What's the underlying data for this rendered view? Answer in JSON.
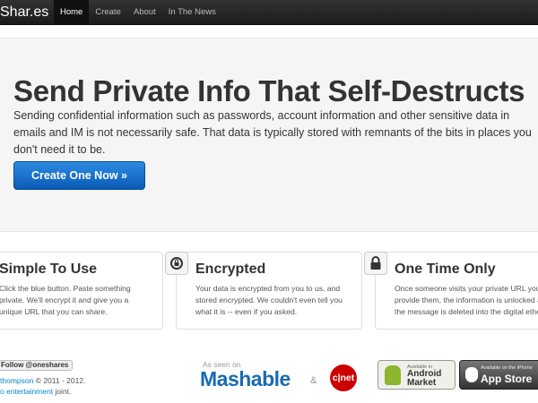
{
  "navbar": {
    "brand": "Shar.es",
    "items": [
      {
        "label": "Home",
        "active": true
      },
      {
        "label": "Create",
        "active": false
      },
      {
        "label": "About",
        "active": false
      },
      {
        "label": "In The News",
        "active": false
      }
    ]
  },
  "hero": {
    "title": "Send Private Info That Self-Destructs",
    "description": "Sending confidential information such as passwords, account information and other sensitive data in emails and IM is not necessarily safe. That data is typically stored with remnants of the bits in places you don't need it to be.",
    "cta_label": "Create One Now »"
  },
  "features": [
    {
      "icon": "lock-icon",
      "title": "Simple To Use",
      "description": "Click the blue button. Paste something private. We'll encrypt it and give you a unique URL that you can share."
    },
    {
      "icon": "refresh-lock-icon",
      "title": "Encrypted",
      "description": "Your data is encrypted from you to us, and stored encrypted. We couldn't even tell you what it is -- even if you asked."
    },
    {
      "icon": "padlock-icon",
      "title": "One Time Only",
      "description": "Once someone visits your private URL you provide them, the information is unlocked and the message is deleted into the digital ether."
    }
  ],
  "footer": {
    "follow_label": "Follow @oneshares",
    "credit_name": "thompson",
    "credit_text": " © 2011 - 2012.",
    "credit_link2": "o entertainment",
    "credit_text2": " joint.",
    "as_seen_on": "As seen on",
    "mashable": "Mashable",
    "amp": "&",
    "cnet": "c|net",
    "android_small": "Available in",
    "android_big1": "Android",
    "android_big2": "Market",
    "appstore_small": "Available on the iPhone",
    "appstore_big": "App Store"
  }
}
